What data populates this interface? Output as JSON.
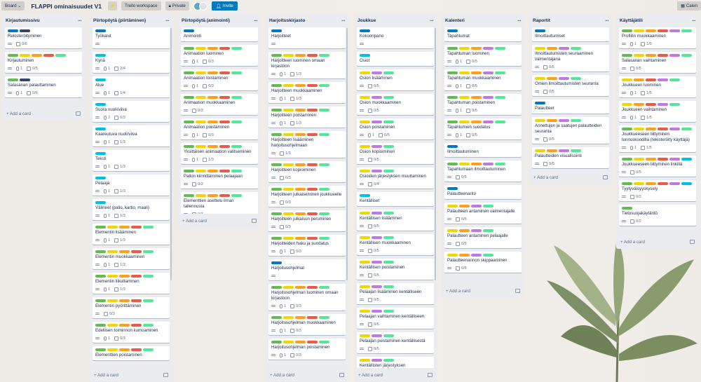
{
  "topbar": {
    "board_label": "Board",
    "title": "FLAPPI ominaisuudet V1",
    "workspace": "Trello workspace",
    "visibility": "Private",
    "invite": "Invite",
    "calendar": "Calen"
  },
  "add_card": "+ Add a card",
  "colors": {
    "green": "#61bd4f",
    "yellow": "#f2d600",
    "orange": "#ff9f1a",
    "red": "#eb5a46",
    "purple": "#c377e0",
    "blue": "#0079bf",
    "sky": "#00c2e0",
    "lime": "#51e898",
    "navy": "#344563"
  },
  "lists": [
    {
      "title": "Kirjautumissivu",
      "cards": [
        {
          "l": [
            "blue",
            "navy"
          ],
          "t": "Rekisteröityminen",
          "d": 1,
          "c": "0/6"
        },
        {
          "l": [
            "green",
            "yellow",
            "orange",
            "red",
            "lime"
          ],
          "t": "Kirjautuminen",
          "d": 1,
          "a": "1",
          "c": "0/5"
        },
        {
          "l": [
            "green",
            "navy"
          ],
          "t": "Salasanan palauttaminen",
          "d": 1,
          "a": "1",
          "c": "0/6"
        }
      ]
    },
    {
      "title": "Piirtopöytä (piirtäminen)",
      "cards": [
        {
          "l": [
            "blue"
          ],
          "t": "Työkalut",
          "d": 1
        },
        {
          "l": [
            "sky"
          ],
          "t": "Kynä",
          "d": 1,
          "a": "1",
          "c": "2/4"
        },
        {
          "l": [
            "sky"
          ],
          "t": "Alue",
          "d": 1,
          "a": "1",
          "c": "1/4"
        },
        {
          "l": [
            "sky"
          ],
          "t": "Suora nuoli/viiva",
          "d": 1,
          "a": "2",
          "c": "0/3"
        },
        {
          "l": [
            "sky"
          ],
          "t": "Kaareutuva nuoli/viiva",
          "d": 1,
          "a": "1",
          "c": "1/3"
        },
        {
          "l": [
            "sky"
          ],
          "t": "Teksti",
          "d": 1,
          "a": "1",
          "c": "1/3"
        },
        {
          "l": [
            "sky"
          ],
          "t": "Pelaaja",
          "d": 1,
          "a": "1",
          "c": "1/3"
        },
        {
          "l": [
            "sky"
          ],
          "t": "Välineet (pallo, kartio, maali)",
          "d": 1,
          "a": "1",
          "c": "1/3"
        },
        {
          "l": [
            "green",
            "yellow",
            "orange",
            "red",
            "lime"
          ],
          "t": "Elementin lisääminen",
          "d": 1,
          "a": "1",
          "c": "1/3"
        },
        {
          "l": [
            "green",
            "yellow",
            "orange",
            "red",
            "lime"
          ],
          "t": "Elementin muokkaaminen",
          "d": 1,
          "a": "1",
          "c": "1/3"
        },
        {
          "l": [
            "green",
            "yellow",
            "orange",
            "red",
            "lime"
          ],
          "t": "Elementin liikuttaminen",
          "d": 1,
          "a": "1",
          "c": "1/3"
        },
        {
          "l": [
            "green",
            "yellow",
            "orange",
            "red",
            "lime"
          ],
          "t": "Elementin pyörittäminen",
          "d": 1,
          "c": "0/3"
        },
        {
          "l": [
            "green",
            "yellow",
            "orange",
            "red",
            "lime"
          ],
          "t": "Edellisen toiminnon kumoaminen",
          "d": 1,
          "a": "1",
          "c": "0/3"
        },
        {
          "l": [
            "green",
            "yellow",
            "orange",
            "red",
            "lime"
          ],
          "t": "Elementtien poistaminen"
        }
      ]
    },
    {
      "title": "Piirtopöytä (animointi)",
      "cards": [
        {
          "l": [
            "blue"
          ],
          "t": "Animointi"
        },
        {
          "l": [
            "green",
            "yellow",
            "orange",
            "red",
            "lime"
          ],
          "t": "Animaation luominen",
          "d": 1,
          "a": "1",
          "c": "0/3"
        },
        {
          "l": [
            "green",
            "yellow",
            "orange",
            "red",
            "lime"
          ],
          "t": "Animaation toistaminen",
          "d": 1,
          "a": "1",
          "c": "0/3"
        },
        {
          "l": [
            "green",
            "yellow",
            "orange",
            "red",
            "lime"
          ],
          "t": "Animaation muokkaaminen",
          "d": 1,
          "c": "0/3"
        },
        {
          "l": [
            "green",
            "yellow",
            "orange",
            "red",
            "lime"
          ],
          "t": "Animaation poistaminen",
          "d": 1,
          "a": "1",
          "c": "0/3"
        },
        {
          "l": [
            "green",
            "yellow",
            "orange",
            "red",
            "lime"
          ],
          "t": "Yksittäisen animaation valitseminen",
          "d": 1,
          "a": "1",
          "c": "1/3"
        },
        {
          "l": [
            "green",
            "yellow",
            "orange",
            "red",
            "lime"
          ],
          "t": "Pallon kiinnittäminen pelaajaan",
          "d": 1,
          "c": "0/3"
        },
        {
          "l": [
            "green",
            "yellow",
            "orange",
            "red",
            "lime"
          ],
          "t": "Elementtien asettelu ilman tallennusta",
          "d": 1,
          "c": "0/3"
        }
      ]
    },
    {
      "title": "Harjoituskirjasto",
      "cards": [
        {
          "l": [
            "blue"
          ],
          "t": "Harjoitteet",
          "d": 1
        },
        {
          "l": [
            "green",
            "yellow",
            "orange",
            "red",
            "lime"
          ],
          "t": "Harjoitteen luominen omaan kirjastoon",
          "d": 1,
          "a": "1",
          "c": "1/3"
        },
        {
          "l": [
            "green",
            "yellow",
            "orange",
            "red",
            "lime"
          ],
          "t": "Harjoitteen muokkaaminen",
          "d": 1,
          "a": "1",
          "c": "1/3"
        },
        {
          "l": [
            "green",
            "yellow",
            "orange",
            "red",
            "lime"
          ],
          "t": "Harjoitteen poistaminen",
          "d": 1,
          "a": "1",
          "c": "1/3"
        },
        {
          "l": [
            "green",
            "yellow",
            "orange",
            "red",
            "lime"
          ],
          "t": "Harjoitteen lisääminen harjoitusohjelmaan",
          "d": 1,
          "c": "1/3"
        },
        {
          "l": [
            "green",
            "yellow",
            "orange",
            "red",
            "lime"
          ],
          "t": "Harjoitteen kopioiminen",
          "d": 1,
          "c": "0/3"
        },
        {
          "l": [
            "green",
            "yellow",
            "orange",
            "red",
            "lime"
          ],
          "t": "Harjoitteen julkaiseminen joukkueelle",
          "d": 1,
          "c": "0/3"
        },
        {
          "l": [
            "green",
            "yellow",
            "orange",
            "red",
            "lime"
          ],
          "t": "Harjoitteen julkaisun peruminen",
          "d": 1,
          "c": "0/3"
        },
        {
          "l": [
            "green",
            "yellow",
            "orange",
            "red",
            "lime"
          ],
          "t": "Harjoitteiden haku ja suodatus",
          "d": 1,
          "a": "1",
          "c": "0/3"
        },
        {
          "l": [
            "blue"
          ],
          "t": "Harjoitusohjelmat",
          "d": 1
        },
        {
          "l": [
            "green",
            "yellow",
            "orange",
            "red",
            "lime"
          ],
          "t": "Harjoitusohjelman luominen omaan kirjastoon",
          "d": 1,
          "a": "1",
          "c": "0/3"
        },
        {
          "l": [
            "green",
            "yellow",
            "orange",
            "red",
            "lime"
          ],
          "t": "Harjoitusohjelman muokkaaminen",
          "d": 1,
          "a": "1",
          "c": "0/3"
        },
        {
          "l": [
            "green",
            "yellow",
            "orange",
            "red",
            "lime"
          ],
          "t": "Harjoitusohjelman poistaminen",
          "d": 1,
          "a": "1",
          "c": "0/3"
        }
      ]
    },
    {
      "title": "Joukkue",
      "cards": [
        {
          "l": [
            "blue"
          ],
          "t": "Kokoonpano",
          "d": 1
        },
        {
          "l": [
            "sky"
          ],
          "t": "Osiot"
        },
        {
          "l": [
            "yellow",
            "purple",
            "lime"
          ],
          "t": "Osion lisääminen",
          "d": 1,
          "c": "0/5"
        },
        {
          "l": [
            "yellow",
            "purple",
            "lime"
          ],
          "t": "Osion muokkaaminen",
          "d": 1,
          "c": "0/5"
        },
        {
          "l": [
            "yellow",
            "purple",
            "lime"
          ],
          "t": "Osion poistaminen",
          "d": 1,
          "a": "1",
          "c": "0/5"
        },
        {
          "l": [
            "yellow",
            "purple",
            "lime"
          ],
          "t": "Osion kopioiminen",
          "d": 1,
          "c": "0/5"
        },
        {
          "l": [
            "yellow",
            "purple",
            "lime"
          ],
          "t": "Osioiden järjestyksen muuttaminen",
          "d": 1,
          "c": "0/4"
        },
        {
          "l": [
            "sky"
          ],
          "t": "Kentälliset"
        },
        {
          "l": [
            "yellow",
            "purple",
            "lime"
          ],
          "t": "Kentällisen lisääminen",
          "d": 1,
          "c": "0/5"
        },
        {
          "l": [
            "yellow",
            "purple",
            "lime"
          ],
          "t": "Kentällisen muokkaaminen",
          "d": 1,
          "c": "0/5"
        },
        {
          "l": [
            "yellow",
            "purple",
            "lime"
          ],
          "t": "Kentällisen poistaminen",
          "d": 1,
          "c": "0/5"
        },
        {
          "l": [
            "yellow",
            "purple",
            "lime"
          ],
          "t": "Pelaajan lisääminen kentälliseen",
          "d": 1,
          "c": "0/5"
        },
        {
          "l": [
            "yellow",
            "purple",
            "lime"
          ],
          "t": "Pelaajan vaihtaminen kentälliseen",
          "d": 1,
          "c": "0/5"
        },
        {
          "l": [
            "yellow",
            "purple",
            "lime"
          ],
          "t": "Pelaajan poistaminen kentällisestä",
          "d": 1,
          "c": "0/5"
        },
        {
          "l": [
            "yellow",
            "purple",
            "lime"
          ],
          "t": "Kentällisten järjestyksen muuttaminen"
        }
      ]
    },
    {
      "title": "Kalenteri",
      "cards": [
        {
          "l": [
            "blue"
          ],
          "t": "Tapahtumat"
        },
        {
          "l": [
            "green",
            "yellow",
            "orange",
            "purple",
            "lime"
          ],
          "t": "Tapahtuman luominen",
          "d": 1,
          "a": "1",
          "c": "0/5"
        },
        {
          "l": [
            "green",
            "yellow",
            "orange",
            "purple",
            "lime"
          ],
          "t": "Tapahtuman muokkaaminen",
          "d": 1,
          "a": "1",
          "c": "0/5"
        },
        {
          "l": [
            "green",
            "yellow",
            "orange",
            "purple",
            "lime"
          ],
          "t": "Tapahtuman poistaminen",
          "d": 1,
          "a": "1",
          "c": "0/5"
        },
        {
          "l": [
            "green",
            "yellow",
            "orange",
            "purple",
            "lime"
          ],
          "t": "Tapahtumien suodatus",
          "d": 1,
          "a": "1",
          "c": "0/5"
        },
        {
          "l": [
            "blue"
          ],
          "t": "Ilmoittautuminen"
        },
        {
          "l": [
            "green",
            "yellow",
            "orange",
            "purple",
            "lime"
          ],
          "t": "Tapahtumaan ilmoittautuminen",
          "d": 1,
          "c": "0/5"
        },
        {
          "l": [
            "blue"
          ],
          "t": "Palautteenanto"
        },
        {
          "l": [
            "yellow",
            "orange",
            "purple",
            "lime"
          ],
          "t": "Palautteen antaminen valmentajalle",
          "d": 1,
          "c": "0/5"
        },
        {
          "l": [
            "yellow",
            "orange",
            "purple",
            "lime"
          ],
          "t": "Palautteen antaminen pelaajalle",
          "d": 1,
          "c": "0/5"
        },
        {
          "l": [
            "yellow",
            "orange",
            "purple",
            "lime"
          ],
          "t": "Palautteenannon skippaaminen",
          "d": 1,
          "c": "0/5"
        }
      ]
    },
    {
      "title": "Raportit",
      "cards": [
        {
          "l": [
            "blue"
          ],
          "t": "Ilmoittautumiset"
        },
        {
          "l": [
            "yellow",
            "orange",
            "purple",
            "lime"
          ],
          "t": "Ilmoittautumisten seuraaminen valmentajana",
          "d": 1,
          "c": "0/5"
        },
        {
          "l": [
            "yellow",
            "orange",
            "purple",
            "lime"
          ],
          "t": "Omien ilmoittautumisten seuranta",
          "d": 1,
          "c": "0/5"
        },
        {
          "l": [
            "blue"
          ],
          "t": "Palautteet"
        },
        {
          "l": [
            "yellow",
            "orange",
            "purple",
            "lime"
          ],
          "t": "Annettujen ja saatujen palautteiden seuranta",
          "d": 1,
          "c": "0/5"
        },
        {
          "l": [
            "yellow",
            "orange",
            "purple",
            "lime"
          ],
          "t": "Palautteiden visualisointi",
          "d": 1,
          "c": "0/5"
        }
      ]
    },
    {
      "title": "Käyttäjätili",
      "cards": [
        {
          "l": [
            "green",
            "yellow",
            "orange",
            "red",
            "purple",
            "lime"
          ],
          "t": "Profiilin muokkaaminen",
          "d": 1,
          "a": "1",
          "c": "1/5"
        },
        {
          "l": [
            "green",
            "yellow",
            "orange",
            "red",
            "purple",
            "lime"
          ],
          "t": "Salasanan vaihtaminen",
          "d": 1,
          "c": "0/5"
        },
        {
          "l": [
            "yellow",
            "orange",
            "red",
            "purple",
            "lime"
          ],
          "t": "Joukkueen luominen",
          "d": 1,
          "a": "1",
          "c": "1/5"
        },
        {
          "l": [
            "yellow",
            "orange",
            "red",
            "purple",
            "lime"
          ],
          "t": "Joukkueen vaihtaminen",
          "d": 1,
          "a": "1",
          "c": "1/5"
        },
        {
          "l": [
            "green",
            "yellow",
            "orange",
            "red",
            "purple",
            "lime"
          ],
          "t": "Joukkueeseen liittyminen tunnuskoodilla (rekisteröity käyttäjä)",
          "d": 1,
          "a": "1",
          "c": "1/5"
        },
        {
          "l": [
            "green",
            "yellow",
            "orange",
            "red",
            "purple",
            "sky"
          ],
          "t": "Joukkueeseen liittyminen linkillä",
          "d": 1,
          "c": "0/5"
        },
        {
          "l": [
            "green",
            "yellow",
            "orange",
            "red",
            "purple",
            "sky"
          ],
          "t": "Tyytyväisyyskysely",
          "d": 1,
          "c": "0/2"
        },
        {
          "l": [
            "green"
          ],
          "t": "Tietosuojakäytäntö",
          "d": 1,
          "c": "0/2"
        }
      ]
    }
  ]
}
